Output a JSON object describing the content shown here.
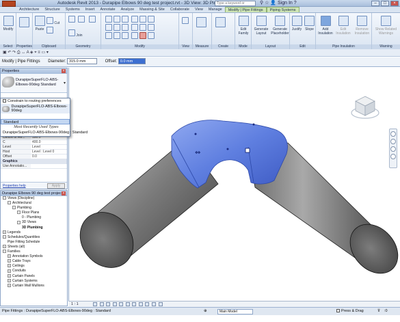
{
  "titlebar": {
    "title": "Autodesk Revit 2013 - Durapipe Elbows 90 deg test project.rvt - 3D View: 3D Plumbing",
    "search_placeholder": "Type a keyword or phrase",
    "sign_in": "Sign In",
    "help": "?"
  },
  "tabs": [
    {
      "label": "Architecture"
    },
    {
      "label": "Structure"
    },
    {
      "label": "Systems"
    },
    {
      "label": "Insert"
    },
    {
      "label": "Annotate"
    },
    {
      "label": "Analyze"
    },
    {
      "label": "Massing & Site"
    },
    {
      "label": "Collaborate"
    },
    {
      "label": "View"
    },
    {
      "label": "Manage"
    },
    {
      "label": "Modify | Pipe Fittings"
    },
    {
      "label": "Piping Systems"
    }
  ],
  "ribbon": {
    "panels": {
      "select": "Select",
      "properties": "Properties",
      "clipboard": "Clipboard",
      "geometry": "Geometry",
      "modify": "Modify",
      "view": "View",
      "measure": "Measure",
      "create": "Create",
      "mode": "Mode",
      "layout": "Layout",
      "edit": "Edit",
      "pipe_insulation": "Pipe Insulation",
      "warning": "Warning"
    },
    "buttons": {
      "modify": "Modify",
      "paste": "Paste",
      "cut": "Cut",
      "join": "Join",
      "edit_family": "Edit\nFamily",
      "generate_layout": "Generate\nLayout",
      "generate_placeholder": "Generate\nPlaceholder",
      "justify": "Justify",
      "slope": "Slope",
      "add_insulation": "Add\nInsulation",
      "edit_insulation": "Edit\nInsulation",
      "remove_insulation": "Remove\nInsulation",
      "show_related_warnings": "Show Related\nWarnings"
    }
  },
  "optionsbar": {
    "context": "Modify | Pipe Fittings",
    "diameter_label": "Diameter:",
    "diameter_value": "315.0 mm",
    "offset_label": "Offset:",
    "offset_value": "0.0 mm"
  },
  "properties": {
    "header": "Properties",
    "type_name": "DurapipeSuperFLO-ABS-Elbows-90deg Standard",
    "rows_top": [
      {
        "k": "Centre of Re...",
        "v": "180.0"
      },
      {
        "k": "C",
        "v": "400.0"
      },
      {
        "k": "Level",
        "v": "Level"
      },
      {
        "k": "Host",
        "v": "Level : Level 0"
      },
      {
        "k": "Offset",
        "v": "0.0"
      }
    ],
    "graphics_section": "Graphics",
    "graphics_row": {
      "k": "Use Annotatio...",
      "v": ""
    },
    "help_link": "Properties help",
    "apply": "Apply"
  },
  "dropdown": {
    "constrain": "Constrain to routing preferences",
    "family": "DurapipeSuperFLO-ABS-Elbows-90deg",
    "type": "Standard",
    "mru_caption": "Most Recently Used Types",
    "mru_item": "DurapipeSuperFLO-ABS-Elbows-90deg : Standard"
  },
  "browser": {
    "header": "Durapipe Elbows 90 deg test project...",
    "items": [
      {
        "indent": 0,
        "box": "−",
        "label": "Views (Discipline)"
      },
      {
        "indent": 1,
        "box": "−",
        "label": "Architectural"
      },
      {
        "indent": 2,
        "box": "−",
        "label": "Plumbing"
      },
      {
        "indent": 3,
        "box": "−",
        "label": "Floor Plans"
      },
      {
        "indent": 4,
        "box": "",
        "label": "0 - Plumbing"
      },
      {
        "indent": 3,
        "box": "−",
        "label": "3D Views"
      },
      {
        "indent": 4,
        "box": "",
        "label": "3D Plumbing",
        "bold": true
      },
      {
        "indent": 0,
        "box": "+",
        "label": "Legends"
      },
      {
        "indent": 0,
        "box": "−",
        "label": "Schedules/Quantities"
      },
      {
        "indent": 1,
        "box": "",
        "label": "Pipe Fitting Schedule"
      },
      {
        "indent": 0,
        "box": "+",
        "label": "Sheets (all)"
      },
      {
        "indent": 0,
        "box": "−",
        "label": "Families"
      },
      {
        "indent": 1,
        "box": "+",
        "label": "Annotation Symbols"
      },
      {
        "indent": 1,
        "box": "+",
        "label": "Cable Trays"
      },
      {
        "indent": 1,
        "box": "+",
        "label": "Ceilings"
      },
      {
        "indent": 1,
        "box": "+",
        "label": "Conduits"
      },
      {
        "indent": 1,
        "box": "+",
        "label": "Curtain Panels"
      },
      {
        "indent": 1,
        "box": "+",
        "label": "Curtain Systems"
      },
      {
        "indent": 1,
        "box": "+",
        "label": "Curtain Wall Mullions"
      }
    ]
  },
  "viewcube": {
    "face_label": "FRONT"
  },
  "viewcontrol": {
    "scale": "1 : 1"
  },
  "status": {
    "text": "Pipe Fittings : DurapipeSuperFLO-ABS-Elbows-90deg : Standard",
    "model": "Main Model",
    "press_drag": "Press & Drag",
    "filter_count": ":0"
  },
  "colors": {
    "fitting_blue": "#6f8fe6",
    "pipe_gray": "#6e6e6e",
    "context_tab": "#cfe6b4"
  }
}
